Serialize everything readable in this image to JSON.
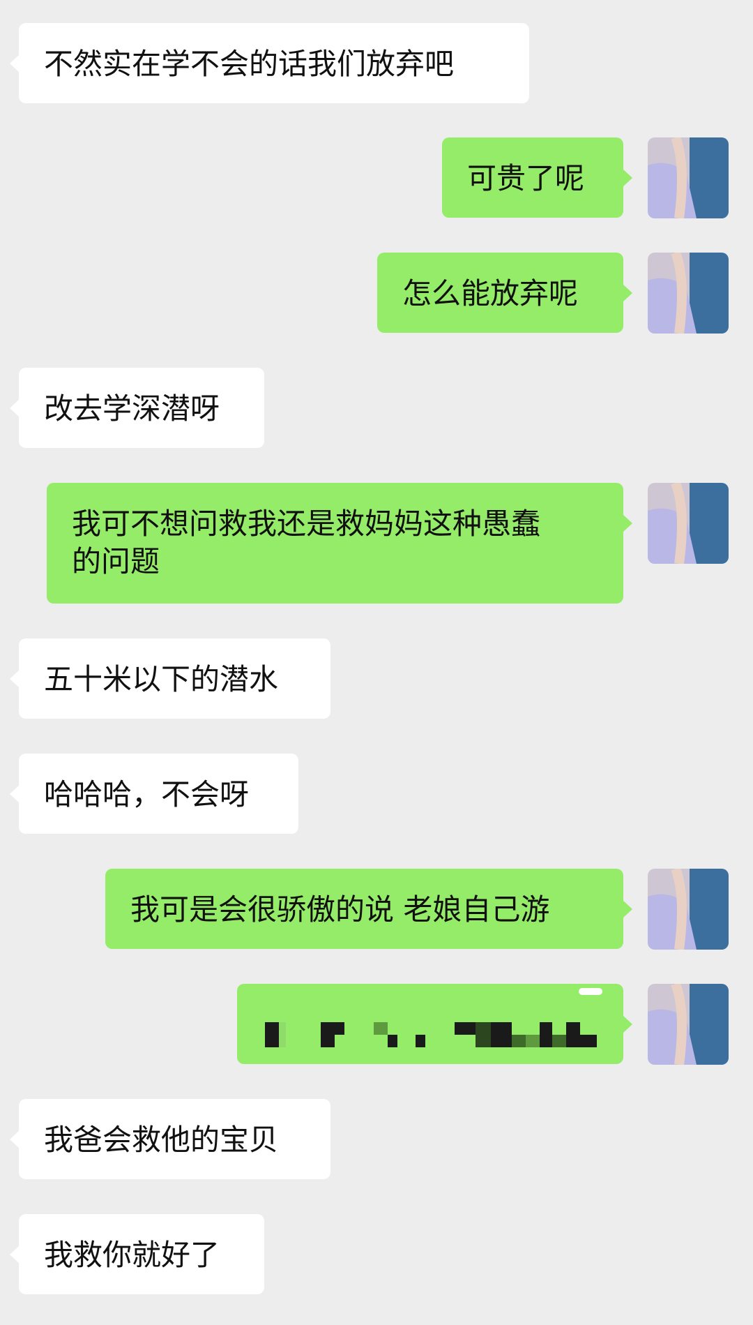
{
  "conversation": {
    "messages": [
      {
        "side": "left",
        "text": "不然实在学不会的话我们放弃吧"
      },
      {
        "side": "right",
        "text": "可贵了呢"
      },
      {
        "side": "right",
        "text": "怎么能放弃呢"
      },
      {
        "side": "left",
        "text": "改去学深潜呀"
      },
      {
        "side": "right",
        "text": "我可不想问救我还是救妈妈这种愚蠢\n的问题"
      },
      {
        "side": "left",
        "text": "五十米以下的潜水"
      },
      {
        "side": "left",
        "text": "哈哈哈，不会呀"
      },
      {
        "side": "right",
        "text": "我可是会很骄傲的说 老娘自己游"
      },
      {
        "side": "right",
        "text": "",
        "redacted": true
      },
      {
        "side": "left",
        "text": "我爸会救他的宝贝"
      },
      {
        "side": "left",
        "text": "我救你就好了"
      }
    ]
  },
  "colors": {
    "background": "#ededed",
    "incoming_bubble": "#ffffff",
    "outgoing_bubble": "#95ec69"
  },
  "icons": {
    "avatar": "user-avatar-photo"
  }
}
